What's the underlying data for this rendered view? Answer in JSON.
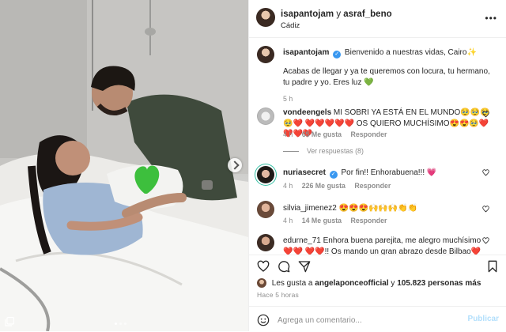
{
  "header": {
    "user1": "isapantojam",
    "joiner": "y",
    "user2": "asraf_beno",
    "location": "Cádiz",
    "more_icon": "more-horizontal-icon"
  },
  "caption": {
    "username": "isapantojam",
    "line1": "Bienvenido a nuestras vidas, Cairo✨",
    "line2": "Acabas de llegar y ya te queremos con locura, tu hermano, tu padre y yo. Eres luz 💚",
    "time": "5 h"
  },
  "comments": [
    {
      "username": "vondeengels",
      "text": "MI SOBRI YA ESTÁ EN EL MUNDO🥹🥹🥹🥹❤️ ❤️❤️❤️❤️❤️ OS QUIERO MUCHÍSIMO😍😍🥹❤️❤️❤️❤️",
      "time": "4 h",
      "likes": "65 Me gusta",
      "reply": "Responder",
      "view_replies": "Ver respuestas (8)"
    },
    {
      "username": "nuriasecret",
      "text": "Por fin!! Enhorabuena!!! 💗",
      "time": "4 h",
      "likes": "226 Me gusta",
      "reply": "Responder"
    },
    {
      "username": "silvia_jimenez2",
      "text": "😍😍😍🙌🙌🙌👏👏",
      "time": "4 h",
      "likes": "14 Me gusta",
      "reply": "Responder"
    },
    {
      "username": "edurne_71",
      "text": "Enhora buena parejita, me alegro muchísimo❤️❤️ ❤️❤️!! Os mando un gran abrazo desde Bilbao❤️❤️❤️❤️!!! Os",
      "time": "",
      "likes": "",
      "reply": ""
    }
  ],
  "likes": {
    "prefix": "Les gusta a",
    "user": "angelaponceofficial",
    "middle": "y",
    "count": "105.823 personas más"
  },
  "timestamp": "Hace 5 horas",
  "add_comment": {
    "placeholder": "Agrega un comentario...",
    "publish": "Publicar"
  },
  "colors": {
    "link_blue": "#3897f0",
    "publish_disabled": "#b2dffc",
    "heart_red": "#ed4956",
    "muted": "#8e8e8e"
  },
  "carousel": {
    "total": 3,
    "active_index": 0
  }
}
